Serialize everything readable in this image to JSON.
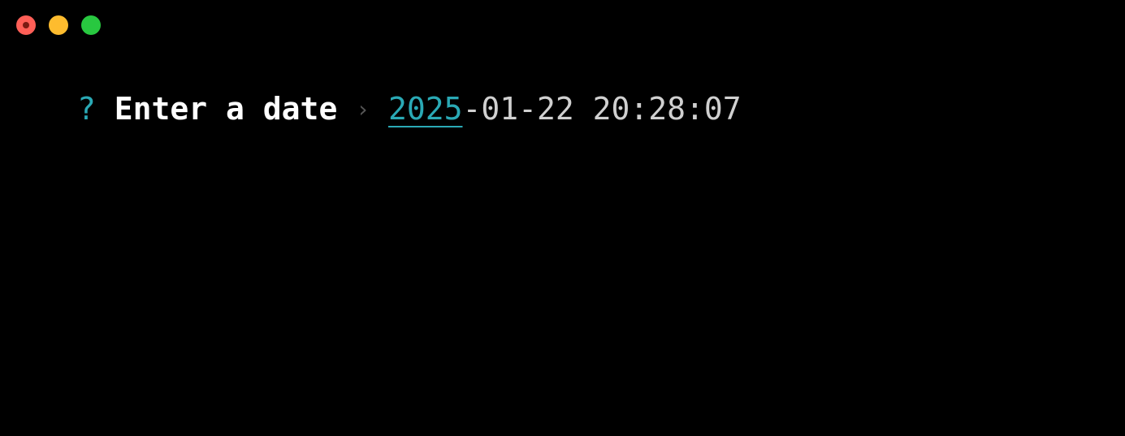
{
  "window": {
    "controls": [
      "close",
      "minimize",
      "zoom"
    ],
    "colors": {
      "close": "#ff5f57",
      "minimize": "#febc2e",
      "zoom": "#28c840",
      "background": "#000000"
    }
  },
  "prompt": {
    "question_mark": "?",
    "message": "Enter a date",
    "separator": "›",
    "value_active": "2025",
    "value_rest": "-01-22 20:28:07",
    "colors": {
      "accent": "#2aa9b5",
      "message": "#ffffff",
      "value": "#d0d0d0",
      "separator": "#555555"
    }
  }
}
